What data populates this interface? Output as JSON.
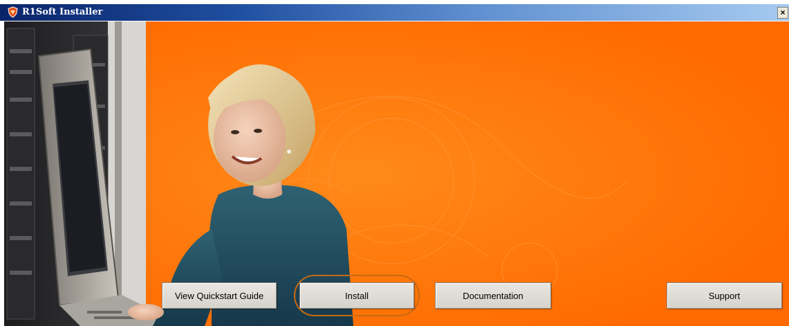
{
  "window": {
    "title": "R1Soft Installer",
    "close_symbol": "×",
    "title_icon": "r1soft-shield-icon",
    "close_icon": "close-icon"
  },
  "banner": {
    "background_color": "#ff7000",
    "image": "woman-at-server-rack-photo"
  },
  "buttons": {
    "quickstart_label": "View Quickstart Guide",
    "install_label": "Install",
    "documentation_label": "Documentation",
    "support_label": "Support"
  },
  "colors": {
    "titlebar_start": "#0a246a",
    "titlebar_end": "#a6caf0",
    "accent_orange": "#ff7000",
    "button_face": "#e0ddd7"
  }
}
